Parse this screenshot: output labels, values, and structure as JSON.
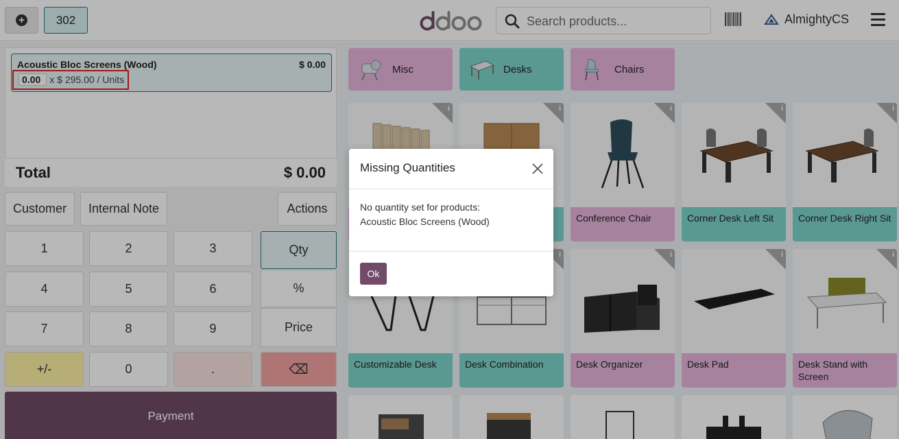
{
  "header": {
    "new_order_symbol": "+",
    "order_number": "302",
    "logo_text": "odoo",
    "search_placeholder": "Search products...",
    "user_name": "AlmightyCS"
  },
  "order": {
    "lines": [
      {
        "name": "Acoustic Bloc Screens (Wood)",
        "price": "$ 0.00",
        "quantity": "0.00",
        "unit_detail": "x $ 295.00 / Units"
      }
    ],
    "total_label": "Total",
    "total_value": "$ 0.00"
  },
  "control_buttons": {
    "customer": "Customer",
    "internal_note": "Internal Note",
    "actions": "Actions"
  },
  "numpad": {
    "keys": [
      "1",
      "2",
      "3",
      "4",
      "5",
      "6",
      "7",
      "8",
      "9",
      "+/-",
      "0",
      "."
    ],
    "modes": [
      "Qty",
      "%",
      "Price"
    ],
    "backspace": "⌫",
    "active_mode": "Qty"
  },
  "payment_label": "Payment",
  "categories": [
    {
      "name": "Misc",
      "color": "#e6b5dd"
    },
    {
      "name": "Desks",
      "color": "#7dd3cb"
    },
    {
      "name": "Chairs",
      "color": "#e6b5dd"
    }
  ],
  "products": [
    {
      "name": "",
      "color": "#e6b5dd",
      "icon": "room-divider-icon"
    },
    {
      "name": "",
      "color": "#7dd3cb",
      "icon": "cabinet-icon"
    },
    {
      "name": "Conference Chair",
      "color": "#e6b5dd",
      "icon": "chair-icon"
    },
    {
      "name": "Corner Desk Left Sit",
      "color": "#7dd3cb",
      "icon": "corner-desk-icon"
    },
    {
      "name": "Corner Desk Right Sit",
      "color": "#7dd3cb",
      "icon": "corner-desk-icon"
    },
    {
      "name": "Customizable Desk",
      "color": "#7dd3cb",
      "icon": "desk-frame-icon"
    },
    {
      "name": "Desk Combination",
      "color": "#7dd3cb",
      "icon": "desk-combination-icon"
    },
    {
      "name": "Desk Organizer",
      "color": "#e6b5dd",
      "icon": "organizer-icon"
    },
    {
      "name": "Desk Pad",
      "color": "#e6b5dd",
      "icon": "desk-pad-icon"
    },
    {
      "name": "Desk Stand with Screen",
      "color": "#e6b5dd",
      "icon": "desk-stand-icon"
    }
  ],
  "info_glyph": "i",
  "modal": {
    "title": "Missing Quantities",
    "line1": "No quantity set for products:",
    "line2": "Acoustic Bloc Screens (Wood)",
    "ok_label": "Ok"
  }
}
